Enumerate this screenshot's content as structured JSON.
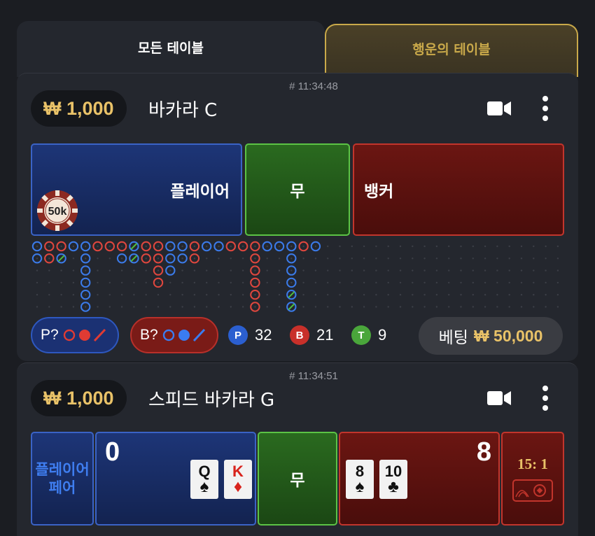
{
  "tabs": {
    "all_tables": "모든 테이블",
    "lucky_tables": "행운의 테이블"
  },
  "table1": {
    "timestamp": "# 11:34:48",
    "limit": "₩ 1,000",
    "name": "바카라 C",
    "player_label": "플레이어",
    "tie_label": "무",
    "banker_label": "뱅커",
    "chip_label": "50k",
    "player_predict": "P?",
    "banker_predict": "B?",
    "stats": {
      "p_letter": "P",
      "p_count": "32",
      "b_letter": "B",
      "b_count": "21",
      "t_letter": "T",
      "t_count": "9"
    },
    "bet_label": "베팅",
    "bet_amount": "₩ 50,000"
  },
  "table2": {
    "timestamp": "# 11:34:51",
    "limit": "₩ 1,000",
    "name": "스피드 바카라 G",
    "player_pair_label": "플레이어 페어",
    "player_score": "0",
    "tie_label": "무",
    "banker_score": "8",
    "player_cards": [
      {
        "rank": "Q",
        "suit": "♠",
        "color": "#111111"
      },
      {
        "rank": "K",
        "suit": "♦",
        "color": "#d8231c"
      }
    ],
    "banker_cards": [
      {
        "rank": "8",
        "suit": "♠",
        "color": "#111111"
      },
      {
        "rank": "10",
        "suit": "♣",
        "color": "#111111"
      }
    ],
    "banker_pair_odds": "15: 1"
  },
  "colors": {
    "gold": "#e9c268",
    "player_blue": "#3a63c6",
    "banker_red": "#c2352c",
    "tie_green": "#5cc345"
  }
}
